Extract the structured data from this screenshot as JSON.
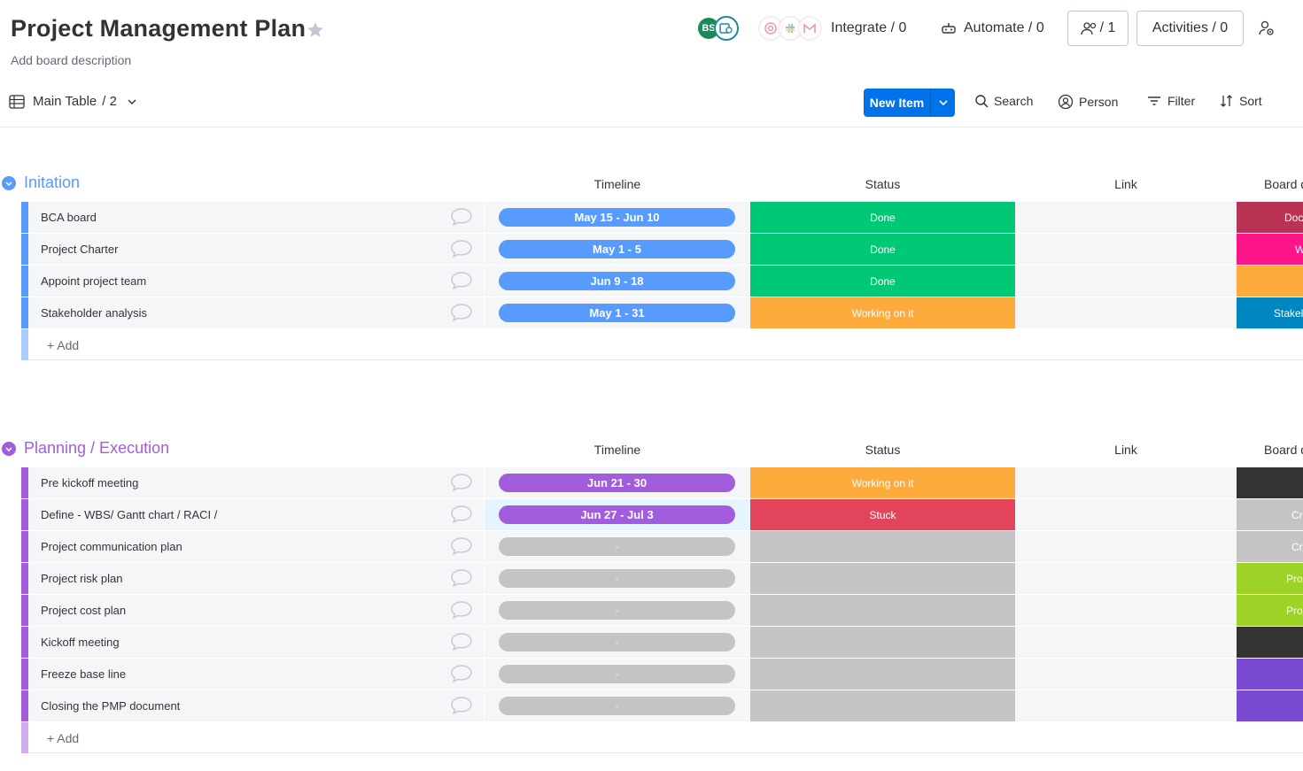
{
  "board": {
    "title": "Project Management Plan",
    "description": "Add board description"
  },
  "header": {
    "avatar_initials": "BS",
    "integrate_label": "Integrate / 0",
    "automate_label": "Automate / 0",
    "members_label": "/ 1",
    "activities_label": "Activities / 0"
  },
  "toolbar": {
    "view_label": "Main Table",
    "view_count": "/ 2",
    "new_item_label": "New Item",
    "search_label": "Search",
    "person_label": "Person",
    "filter_label": "Filter",
    "sort_label": "Sort"
  },
  "columns": {
    "timeline": "Timeline",
    "status": "Status",
    "link": "Link",
    "board": "Board d"
  },
  "colors": {
    "done": "#00c875",
    "working": "#fdab3d",
    "stuck": "#e2445c",
    "empty": "#c4c4c4",
    "initiation": "#579bfc",
    "planning": "#a25ddc",
    "primary": "#0073ea"
  },
  "groups": [
    {
      "title": "Initation",
      "color": "#579bfc",
      "add_label": "+ Add",
      "items": [
        {
          "name": "BCA board",
          "timeline": "May 15 - Jun 10",
          "status": "Done",
          "board": "Doc"
        },
        {
          "name": "Project Charter",
          "timeline": "May 1 - 5",
          "status": "Done",
          "board": "W"
        },
        {
          "name": "Appoint project team",
          "timeline": "Jun 9 - 18",
          "status": "Done",
          "board": ""
        },
        {
          "name": "Stakeholder analysis",
          "timeline": "May 1 - 31",
          "status": "Working on it",
          "board": "Stakel"
        }
      ]
    },
    {
      "title": "Planning / Execution",
      "color": "#a25ddc",
      "add_label": "+ Add",
      "items": [
        {
          "name": "Pre kickoff meeting",
          "timeline": "Jun 21 - 30",
          "status": "Working on it",
          "board": ""
        },
        {
          "name": "Define - WBS/ Gantt chart / RACI /",
          "timeline": "Jun 27 - Jul 3",
          "status": "Stuck",
          "board": "Cr"
        },
        {
          "name": "Project communication plan",
          "timeline": "-",
          "status": "",
          "board": "Cr"
        },
        {
          "name": "Project risk plan",
          "timeline": "-",
          "status": "",
          "board": "Pro"
        },
        {
          "name": "Project cost plan",
          "timeline": "-",
          "status": "",
          "board": "Pro"
        },
        {
          "name": "Kickoff meeting",
          "timeline": "-",
          "status": "",
          "board": ""
        },
        {
          "name": "Freeze base line",
          "timeline": "-",
          "status": "",
          "board": ""
        },
        {
          "name": "Closing the PMP document",
          "timeline": "-",
          "status": "",
          "board": ""
        }
      ]
    }
  ]
}
